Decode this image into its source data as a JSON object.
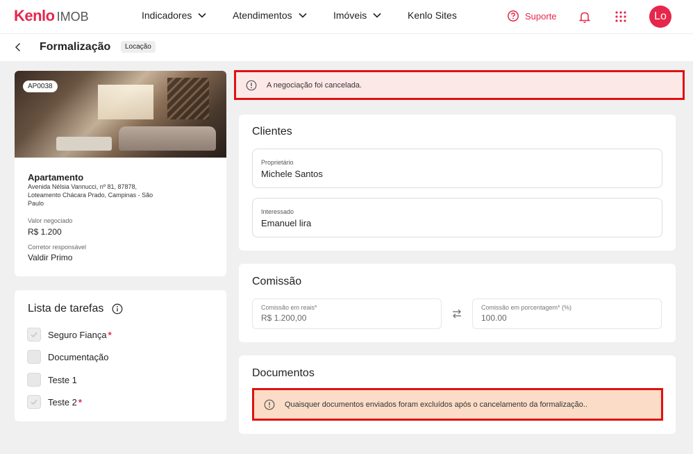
{
  "brand": {
    "name": "Kenlo",
    "product": "IMOB"
  },
  "nav": {
    "items": [
      {
        "label": "Indicadores",
        "dropdown": true
      },
      {
        "label": "Atendimentos",
        "dropdown": true
      },
      {
        "label": "Imóveis",
        "dropdown": true
      },
      {
        "label": "Kenlo Sites",
        "dropdown": false
      }
    ],
    "support_label": "Suporte",
    "avatar_initials": "Lo"
  },
  "colors": {
    "brand": "#e6264b",
    "alert_red": "#e01010",
    "alert_cancel_bg": "#fde8e8",
    "alert_docs_bg": "#fbdcc6"
  },
  "page": {
    "title": "Formalização",
    "badge": "Locação"
  },
  "property": {
    "code": "AP0038",
    "type": "Apartamento",
    "address": "Avenida Nélsia Vannucci, nº 81, 87878, Loteamento Chácara Prado, Campinas - São Paulo",
    "value_label": "Valor negociado",
    "value": "R$ 1.200",
    "broker_label": "Corretor responsável",
    "broker": "Valdir Primo"
  },
  "tasks": {
    "title": "Lista de tarefas",
    "items": [
      {
        "label": "Seguro Fiança",
        "checked": true,
        "required": "*"
      },
      {
        "label": "Documentação",
        "checked": false,
        "required": ""
      },
      {
        "label": "Teste 1",
        "checked": false,
        "required": ""
      },
      {
        "label": "Teste 2",
        "checked": true,
        "required": "*"
      }
    ]
  },
  "alert_cancel": {
    "message": "A negociação foi cancelada."
  },
  "clients": {
    "title": "Clientes",
    "owner_label": "Proprietário",
    "owner": "Michele Santos",
    "interested_label": "Interessado",
    "interested": "Emanuel lira"
  },
  "commission": {
    "title": "Comissão",
    "reais_label": "Comissão em reais*",
    "reais_value": "R$ 1.200,00",
    "percent_label": "Comissão em porcentagem* (%)",
    "percent_value": "100.00"
  },
  "documents": {
    "title": "Documentos",
    "alert": "Quaisquer documentos enviados foram excluídos após o cancelamento da formalização.."
  }
}
